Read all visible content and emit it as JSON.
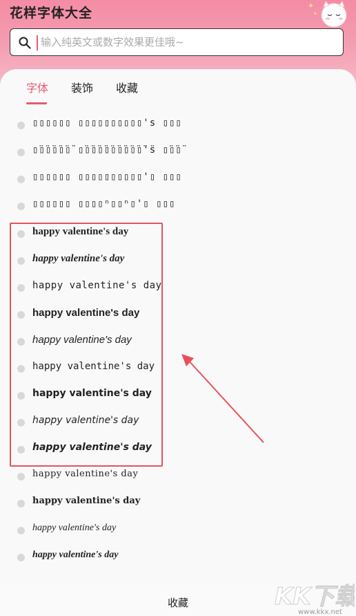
{
  "app": {
    "title": "花样字体大全"
  },
  "search": {
    "placeholder": "输入纯英文或数字效果更佳哦~",
    "value": ""
  },
  "tabs": [
    {
      "label": "字体",
      "active": true
    },
    {
      "label": "装饰",
      "active": false
    },
    {
      "label": "收藏",
      "active": false
    }
  ],
  "font_items": [
    {
      "text": "▯▯▯▯▯▯ ▯▯▯▯▯▯▯▯▯▯'s ▯▯▯",
      "style": "boxes"
    },
    {
      "text": "▯̈▯̈▯̈▯̈▯̈▯̈ ▯̈▯̈▯̈▯̈▯̈▯̈▯̈▯̈▯̈▯̈'s̈ ▯̈▯̈▯̈",
      "style": "boxes-diaeresis"
    },
    {
      "text": "▯▯▯▯▯▯ ▯▯▯▯▯▯▯▯▯▯'▯ ▯▯▯",
      "style": "boxes"
    },
    {
      "text": "▯▯▯▯▯▯ ▯▯▯▯ⁿ▯▯ⁿ▯'▯ ▯▯▯",
      "style": "boxes"
    },
    {
      "text": "happy valentine's day",
      "style": "serif-bold"
    },
    {
      "text": "happy valentine's day",
      "style": "serif-bold-italic"
    },
    {
      "text": "happy valentine's day",
      "style": "mono"
    },
    {
      "text": "happy valentine's day",
      "style": "sans-bold"
    },
    {
      "text": "happy valentine's day",
      "style": "sans-italic"
    },
    {
      "text": "happy valentine's day",
      "style": "dejavu-mono"
    },
    {
      "text": "happy valentine's day",
      "style": "dejavu-bold"
    },
    {
      "text": "happy valentine's day",
      "style": "dejavu-italic"
    },
    {
      "text": "happy valentine's day",
      "style": "dejavu-bold-italic"
    },
    {
      "text": "happy valentine's day",
      "style": "gothic"
    },
    {
      "text": "happy valentine's day",
      "style": "gothic-bold"
    },
    {
      "text": "happy valentine's day",
      "style": "script"
    },
    {
      "text": "happy valentine's day",
      "style": "script-bold"
    }
  ],
  "bottom": {
    "label": "收藏"
  },
  "watermark": {
    "text": "KK下载",
    "url": "www.kkx.net"
  },
  "icons": {
    "search": "search-icon",
    "mascot": "cat-mascot-icon"
  },
  "colors": {
    "accent": "#e75a6e",
    "header_gradient": "#f48ca4",
    "annotation": "#e8515c"
  }
}
